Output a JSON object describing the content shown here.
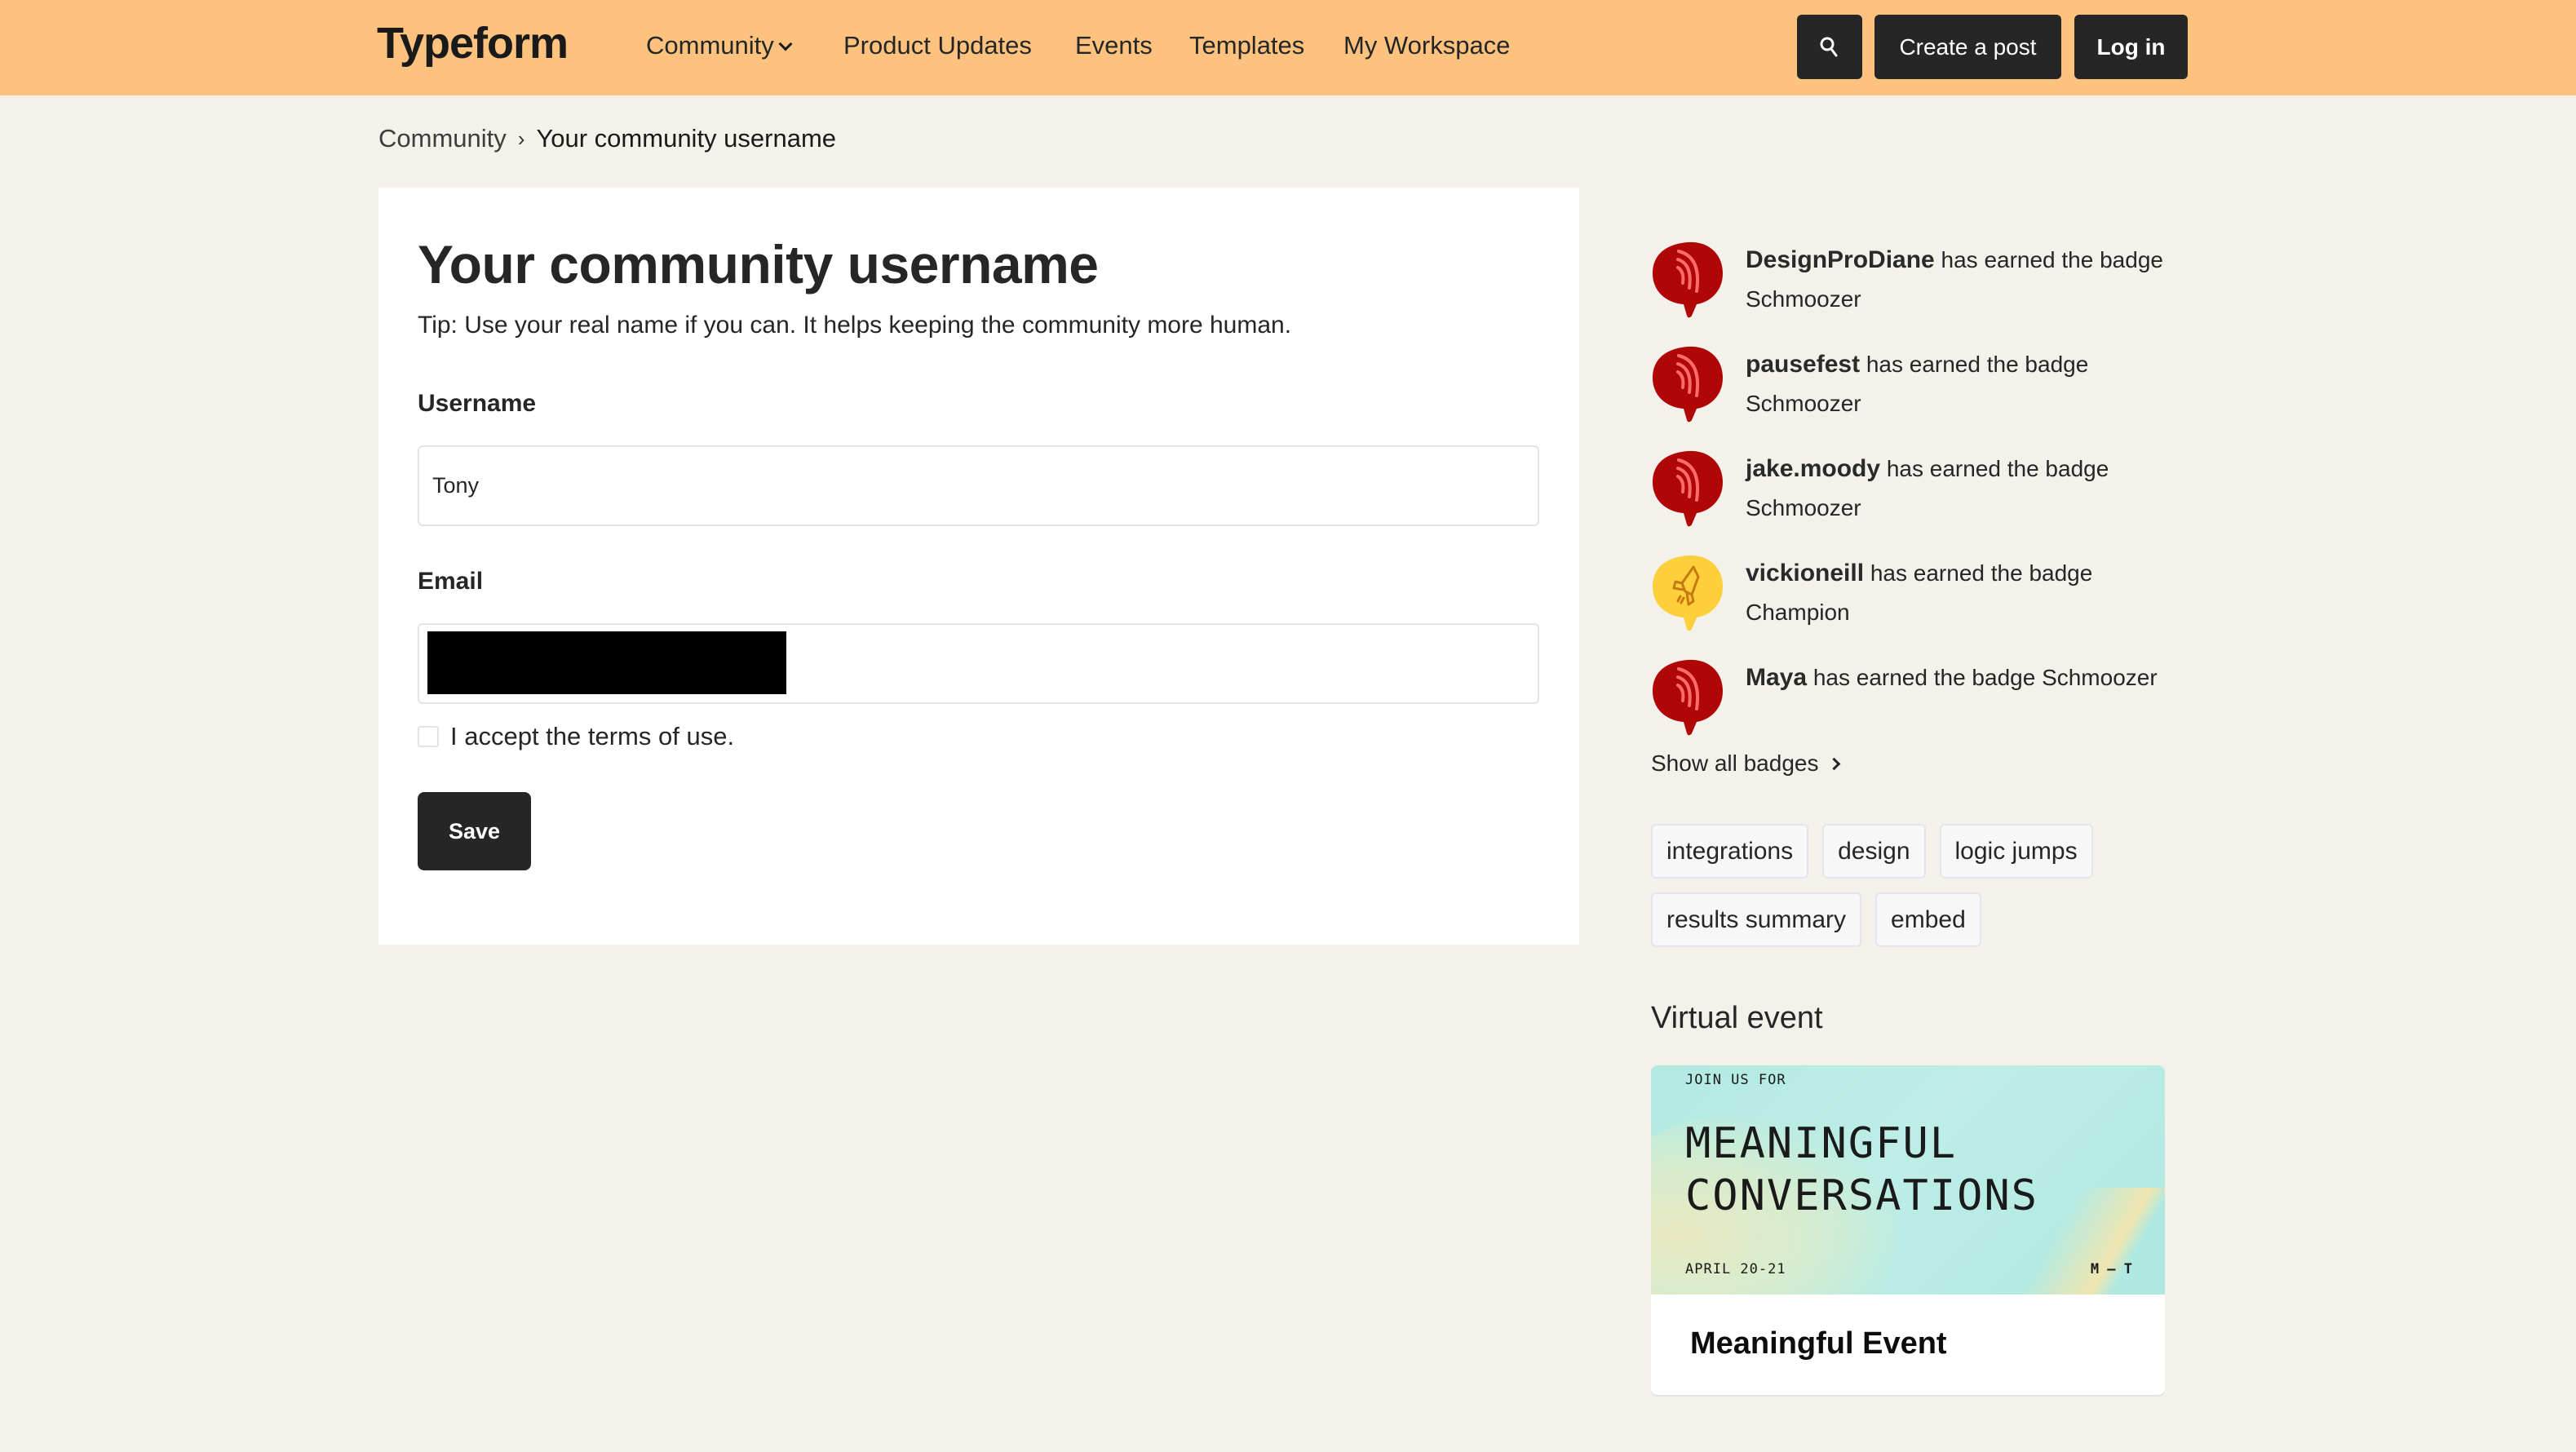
{
  "header": {
    "logo": "Typeform",
    "nav": [
      {
        "label": "Community",
        "has_dropdown": true
      },
      {
        "label": "Product Updates"
      },
      {
        "label": "Events"
      },
      {
        "label": "Templates"
      },
      {
        "label": "My Workspace"
      }
    ],
    "search_icon": "search-icon",
    "create_post_label": "Create a post",
    "login_label": "Log in",
    "background_color": "#FEC27F"
  },
  "breadcrumb": {
    "items": [
      "Community",
      "Your community username"
    ]
  },
  "form": {
    "title": "Your community username",
    "tip": "Tip: Use your real name if you can. It helps keeping the community more human.",
    "username_label": "Username",
    "username_value": "Tony",
    "email_label": "Email",
    "email_value": "",
    "terms_label": "I accept the terms of use.",
    "terms_checked": false,
    "save_label": "Save"
  },
  "sidebar": {
    "badges": [
      {
        "user": "DesignProDiane",
        "text": "has earned the badge",
        "badge": "Schmoozer",
        "icon": "speech-bubble-signal-icon",
        "color": "#B00606"
      },
      {
        "user": "pausefest",
        "text": "has earned the badge",
        "badge": "Schmoozer",
        "icon": "speech-bubble-signal-icon",
        "color": "#B00606"
      },
      {
        "user": "jake.moody",
        "text": "has earned the badge",
        "badge": "Schmoozer",
        "icon": "speech-bubble-signal-icon",
        "color": "#B00606"
      },
      {
        "user": "vickioneill",
        "text": "has earned the badge",
        "badge": "Champion",
        "icon": "speech-bubble-rocket-icon",
        "color": "#FDCF3A"
      },
      {
        "user": "Maya",
        "text": "has earned the badge",
        "badge": "Schmoozer",
        "icon": "speech-bubble-signal-icon",
        "color": "#B00606"
      }
    ],
    "show_all_label": "Show all badges",
    "tags": [
      "integrations",
      "design",
      "logic jumps",
      "results summary",
      "embed"
    ],
    "virtual_event_heading": "Virtual event",
    "event": {
      "image_kicker": "JOIN US FOR",
      "image_title_line1": "MEANINGFUL",
      "image_title_line2": "CONVERSATIONS",
      "image_date": "APRIL 20-21",
      "image_mark": "M — T",
      "title": "Meaningful Event"
    }
  }
}
